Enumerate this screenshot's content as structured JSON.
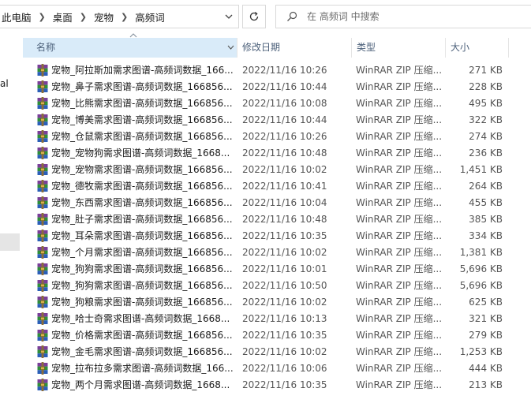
{
  "address_bar": {
    "breadcrumbs": [
      "此电脑",
      "桌面",
      "宠物",
      "高频词"
    ]
  },
  "search": {
    "placeholder": "在 高频词 中搜索"
  },
  "nav_pane": {
    "partial_label": "al"
  },
  "columns": {
    "name": "名称",
    "date": "修改日期",
    "type": "类型",
    "size": "大小"
  },
  "files": [
    {
      "name": "宠物_阿拉斯加需求图谱-高频词数据_166...",
      "date": "2022/11/16 10:26",
      "type": "WinRAR ZIP 压缩...",
      "size": "271 KB"
    },
    {
      "name": "宠物_鼻子需求图谱-高频词数据_166856...",
      "date": "2022/11/16 10:44",
      "type": "WinRAR ZIP 压缩...",
      "size": "228 KB"
    },
    {
      "name": "宠物_比熊需求图谱-高频词数据_166856...",
      "date": "2022/11/16 10:08",
      "type": "WinRAR ZIP 压缩...",
      "size": "495 KB"
    },
    {
      "name": "宠物_博美需求图谱-高频词数据_166856...",
      "date": "2022/11/16 10:44",
      "type": "WinRAR ZIP 压缩...",
      "size": "322 KB"
    },
    {
      "name": "宠物_仓鼠需求图谱-高频词数据_166856...",
      "date": "2022/11/16 10:26",
      "type": "WinRAR ZIP 压缩...",
      "size": "274 KB"
    },
    {
      "name": "宠物_宠物狗需求图谱-高频词数据_1668...",
      "date": "2022/11/16 10:48",
      "type": "WinRAR ZIP 压缩...",
      "size": "236 KB"
    },
    {
      "name": "宠物_宠物需求图谱-高频词数据_166856...",
      "date": "2022/11/16 10:02",
      "type": "WinRAR ZIP 压缩...",
      "size": "1,451 KB"
    },
    {
      "name": "宠物_德牧需求图谱-高频词数据_166856...",
      "date": "2022/11/16 10:41",
      "type": "WinRAR ZIP 压缩...",
      "size": "264 KB"
    },
    {
      "name": "宠物_东西需求图谱-高频词数据_166856...",
      "date": "2022/11/16 10:04",
      "type": "WinRAR ZIP 压缩...",
      "size": "455 KB"
    },
    {
      "name": "宠物_肚子需求图谱-高频词数据_166856...",
      "date": "2022/11/16 10:48",
      "type": "WinRAR ZIP 压缩...",
      "size": "385 KB"
    },
    {
      "name": "宠物_耳朵需求图谱-高频词数据_166856...",
      "date": "2022/11/16 10:35",
      "type": "WinRAR ZIP 压缩...",
      "size": "334 KB"
    },
    {
      "name": "宠物_个月需求图谱-高频词数据_166856...",
      "date": "2022/11/16 10:02",
      "type": "WinRAR ZIP 压缩...",
      "size": "1,381 KB"
    },
    {
      "name": "宠物_狗狗需求图谱-高频词数据_166856...",
      "date": "2022/11/16 10:01",
      "type": "WinRAR ZIP 压缩...",
      "size": "5,696 KB"
    },
    {
      "name": "宠物_狗狗需求图谱-高频词数据_166856...",
      "date": "2022/11/16 10:50",
      "type": "WinRAR ZIP 压缩...",
      "size": "5,696 KB"
    },
    {
      "name": "宠物_狗粮需求图谱-高频词数据_166856...",
      "date": "2022/11/16 10:02",
      "type": "WinRAR ZIP 压缩...",
      "size": "625 KB"
    },
    {
      "name": "宠物_哈士奇需求图谱-高频词数据_1668...",
      "date": "2022/11/16 10:13",
      "type": "WinRAR ZIP 压缩...",
      "size": "321 KB"
    },
    {
      "name": "宠物_价格需求图谱-高频词数据_166856...",
      "date": "2022/11/16 10:35",
      "type": "WinRAR ZIP 压缩...",
      "size": "279 KB"
    },
    {
      "name": "宠物_金毛需求图谱-高频词数据_166856...",
      "date": "2022/11/16 10:02",
      "type": "WinRAR ZIP 压缩...",
      "size": "1,253 KB"
    },
    {
      "name": "宠物_拉布拉多需求图谱-高频词数据_166...",
      "date": "2022/11/16 10:06",
      "type": "WinRAR ZIP 压缩...",
      "size": "444 KB"
    },
    {
      "name": "宠物_两个月需求图谱-高频词数据_1668...",
      "date": "2022/11/16 10:35",
      "type": "WinRAR ZIP 压缩...",
      "size": "213 KB"
    }
  ]
}
